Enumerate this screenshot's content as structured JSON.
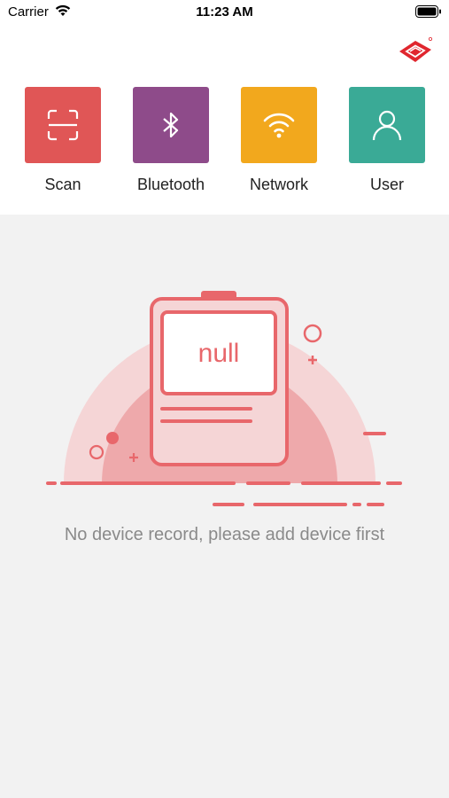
{
  "status_bar": {
    "carrier": "Carrier",
    "time": "11:23 AM"
  },
  "actions": [
    {
      "label": "Scan",
      "color": "#e05656",
      "icon": "scan-icon"
    },
    {
      "label": "Bluetooth",
      "color": "#8e4b8a",
      "icon": "bluetooth-icon"
    },
    {
      "label": "Network",
      "color": "#f2a81d",
      "icon": "wifi-icon"
    },
    {
      "label": "User",
      "color": "#3aaa96",
      "icon": "user-icon"
    }
  ],
  "empty_state": {
    "screen_text": "null",
    "message": "No device record, please add device first"
  },
  "colors": {
    "brand_red": "#e24f55",
    "illustration_red": "#e8676b"
  }
}
